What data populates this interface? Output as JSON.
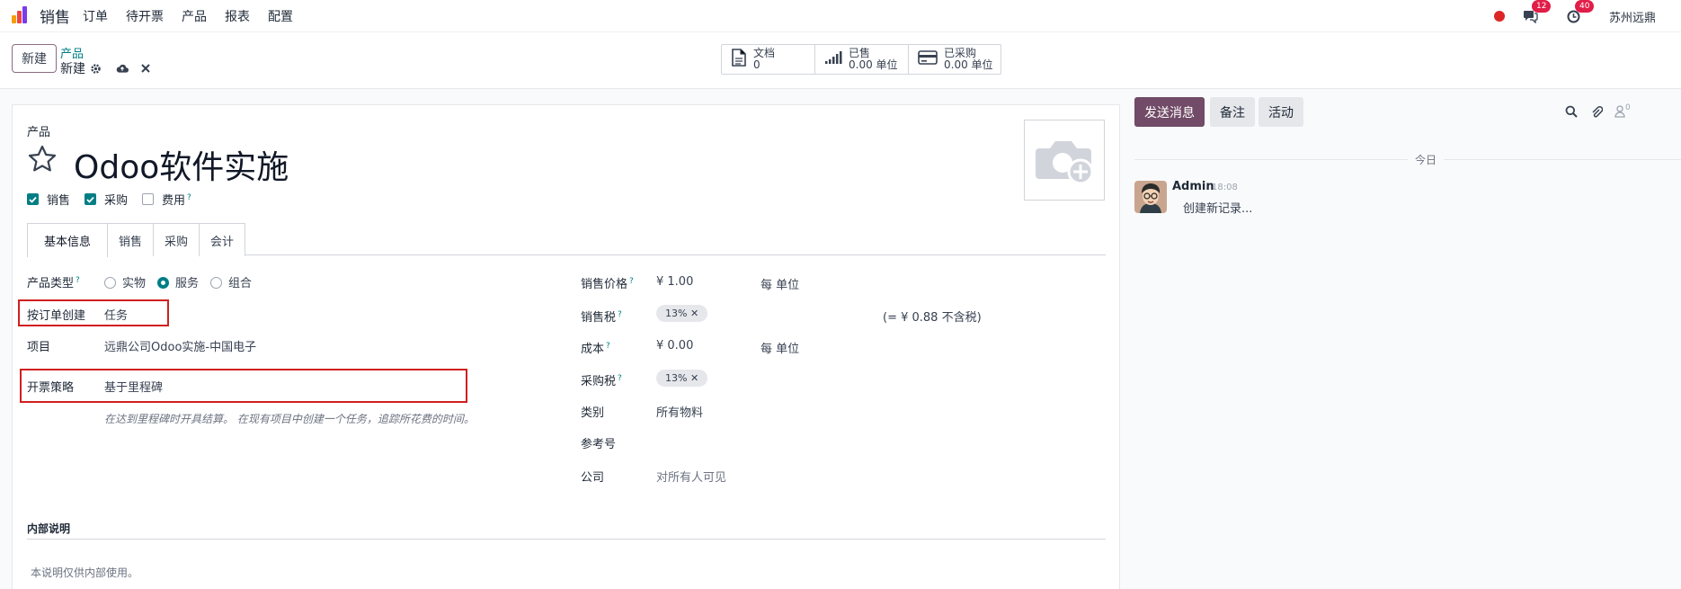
{
  "navbar": {
    "app_name": "销售",
    "menu": [
      "订单",
      "待开票",
      "产品",
      "报表",
      "配置"
    ],
    "chat_badge": "12",
    "activity_badge": "40",
    "company": "苏州远鼎"
  },
  "control": {
    "new_label": "新建",
    "breadcrumb_parent": "产品",
    "breadcrumb_current": "新建",
    "smart_buttons": [
      {
        "title": "文档",
        "value": "0",
        "icon": "document-icon"
      },
      {
        "title": "已售",
        "value": "0.00 单位",
        "icon": "signal-chart-icon"
      },
      {
        "title": "已采购",
        "value": "0.00 单位",
        "icon": "credit-card-icon"
      }
    ]
  },
  "form": {
    "record_type_label": "产品",
    "title": "Odoo软件实施",
    "checkboxes": [
      {
        "label": "销售",
        "checked": true,
        "help": false
      },
      {
        "label": "采购",
        "checked": true,
        "help": false
      },
      {
        "label": "费用",
        "checked": false,
        "help": true
      }
    ],
    "help_mark": "?",
    "tabs": [
      "基本信息",
      "销售",
      "采购",
      "会计"
    ],
    "active_tab": "基本信息",
    "left": {
      "product_type_label": "产品类型",
      "product_type_options": [
        "实物",
        "服务",
        "组合"
      ],
      "product_type_selected": "服务",
      "create_on_order_label": "按订单创建",
      "create_on_order_value": "任务",
      "project_label": "项目",
      "project_value": "远鼎公司Odoo实施-中国电子",
      "invoicing_policy_label": "开票策略",
      "invoicing_policy_value": "基于里程碑",
      "invoicing_policy_note": "在达到里程碑时开具结算。 在现有项目中创建一个任务，追踪所花费的时间。"
    },
    "right": {
      "sales_price_label": "销售价格",
      "sales_price_value": "¥ 1.00",
      "sales_price_unit": "每 单位",
      "sales_tax_label": "销售税",
      "sales_tax_tag": "13%",
      "tax_excluded_note": "(= ¥ 0.88 不含税)",
      "cost_label": "成本",
      "cost_value": "¥ 0.00",
      "cost_unit": "每 单位",
      "purchase_tax_label": "采购税",
      "purchase_tax_tag": "13%",
      "category_label": "类别",
      "category_value": "所有物料",
      "reference_label": "参考号",
      "company_label": "公司",
      "company_placeholder": "对所有人可见"
    },
    "internal_notes_label": "内部说明",
    "internal_notes_placeholder": "本说明仅供内部使用。"
  },
  "chatter": {
    "send_message": "发送消息",
    "log_note": "备注",
    "activity": "活动",
    "followers_count": "0",
    "today": "今日",
    "message": {
      "author": "Admin",
      "time": "18:08",
      "body": "创建新记录..."
    }
  },
  "colors": {
    "primary": "#714b67",
    "accent": "#017e84",
    "badge": "#e11d48",
    "highlight_box": "#d11f1f"
  }
}
